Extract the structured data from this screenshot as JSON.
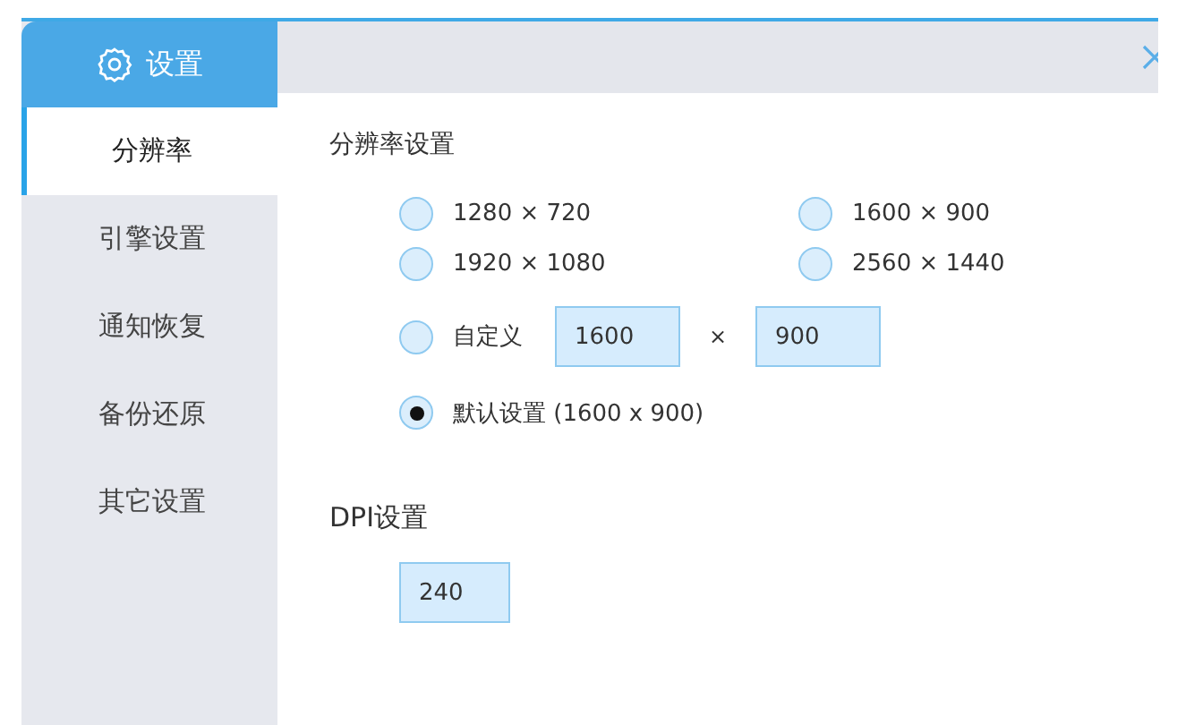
{
  "sidebar": {
    "title": "设置",
    "items": [
      {
        "label": "分辨率",
        "selected": true
      },
      {
        "label": "引擎设置",
        "selected": false
      },
      {
        "label": "通知恢复",
        "selected": false
      },
      {
        "label": "备份还原",
        "selected": false
      },
      {
        "label": "其它设置",
        "selected": false
      }
    ]
  },
  "resolution": {
    "title": "分辨率设置",
    "options": [
      {
        "label": "1280 × 720",
        "selected": false
      },
      {
        "label": "1600 × 900",
        "selected": false
      },
      {
        "label": "1920 × 1080",
        "selected": false
      },
      {
        "label": "2560 × 1440",
        "selected": false
      }
    ],
    "custom": {
      "label": "自定义",
      "selected": false,
      "width_value": "1600",
      "separator": "×",
      "height_value": "900"
    },
    "default": {
      "label": "默认设置 (1600 x 900)",
      "selected": true
    }
  },
  "dpi": {
    "title": "DPI设置",
    "value": "240"
  }
}
